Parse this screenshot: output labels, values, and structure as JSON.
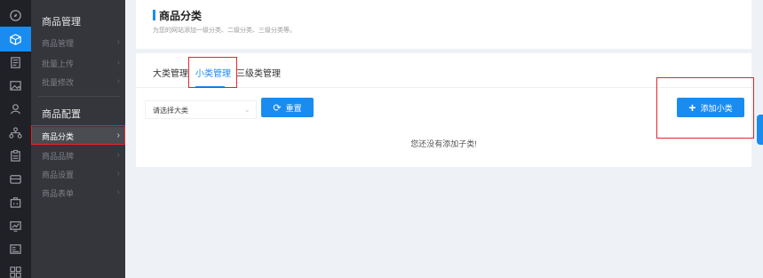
{
  "rail": {
    "icons": [
      "compass-icon",
      "cube-icon",
      "document-icon",
      "image-icon",
      "user-icon",
      "org-chart-icon",
      "clipboard-icon",
      "wallet-icon",
      "toolbox-icon",
      "chart-monitor-icon",
      "id-card-icon",
      "grid-icon"
    ],
    "active_index": 1
  },
  "submenu": {
    "group1_title": "商品管理",
    "group1_items": [
      "商品管理",
      "批量上传",
      "批量修改"
    ],
    "group2_title": "商品配置",
    "group2_items": [
      "商品分类",
      "商品品牌",
      "商品设置",
      "商品表单"
    ],
    "active_item": "商品分类",
    "chevron": "›"
  },
  "header": {
    "title": "商品分类",
    "subtitle": "为您的网站添加一级分类、二级分类、三级分类等。"
  },
  "tabs": [
    "大类管理",
    "小类管理",
    "三级类管理"
  ],
  "active_tab": "小类管理",
  "filter": {
    "select_value": "请选择大类",
    "caret": "⌄",
    "reset_icon": "⟳",
    "reset_label": "重置"
  },
  "add_button": {
    "icon": "+",
    "label": "添加小类"
  },
  "empty_message": "您还没有添加子类!",
  "colors": {
    "accent": "#1a8cf0",
    "rail_bg": "#1f2126",
    "submenu_bg": "#34363b",
    "highlight_box": "#e0262b",
    "page_bg": "#eef2f6"
  }
}
